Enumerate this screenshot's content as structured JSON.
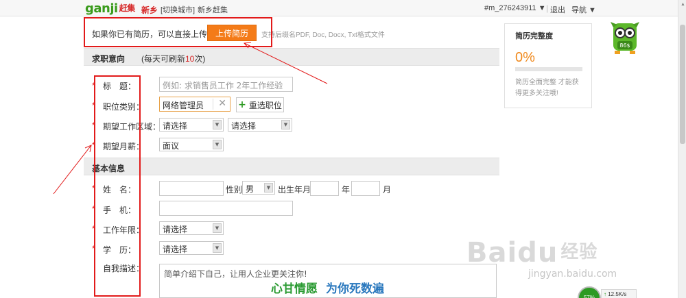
{
  "topbar": {
    "logo": "ganji",
    "logo_cn": "赶集",
    "city": "新乡",
    "switch_city": "[切换城市]",
    "city_ganji": "新乡赶集",
    "account": "#m_276243911 ▼",
    "separator": "|",
    "logout": "退出",
    "nav": "导航 ▼"
  },
  "upload": {
    "prompt": "如果你已有简历，可以直接上传。",
    "button": "上传简历",
    "hint": "支持后缀名PDF, Doc, Docx, Txt格式文件"
  },
  "job_intent": {
    "title": "求职意向",
    "sub_prefix": "(每天可刷新",
    "sub_count": "10",
    "sub_suffix": "次)",
    "fields": {
      "title_label": "标　题：",
      "title_placeholder": "例如: 求销售员工作 2年工作经验",
      "category_label": "职位类别：",
      "category_value": "网络管理员",
      "reselect_label": "重选职位",
      "area_label": "期望工作区域：",
      "area_select1": "请选择",
      "area_select2": "请选择",
      "salary_label": "期望月薪：",
      "salary_value": "面议"
    }
  },
  "basic_info": {
    "title": "基本信息",
    "name_label": "姓　名：",
    "gender_label": "性别",
    "gender_value": "男",
    "birth_label": "出生年月",
    "year_label": "年",
    "month_label": "月",
    "phone_label": "手　机：",
    "experience_label": "工作年限：",
    "experience_value": "请选择",
    "education_label": "学　历：",
    "education_value": "请选择",
    "self_desc_label": "自我描述：",
    "self_desc_placeholder": "简单介绍下自己，让用人企业更关注你!"
  },
  "required_star": "*",
  "completeness": {
    "title": "简历完整度",
    "percent": "0%",
    "progress": 0,
    "tip": "简历全面完整 才能获得更多关注哦!"
  },
  "mascot_badge": "86$",
  "watermark": {
    "brand": "Baidu",
    "brand_cn": "经验",
    "url": "jingyan.baidu.com"
  },
  "banner": {
    "left": "心甘情愿",
    "right": "为你死数遍"
  },
  "net_speed": {
    "percent": "57%",
    "up": "↑",
    "rate": "12.5K/s"
  },
  "colors": {
    "accent_orange": "#f47b18",
    "annotation_red": "#e21a1a",
    "brand_green": "#3a9b1c"
  }
}
